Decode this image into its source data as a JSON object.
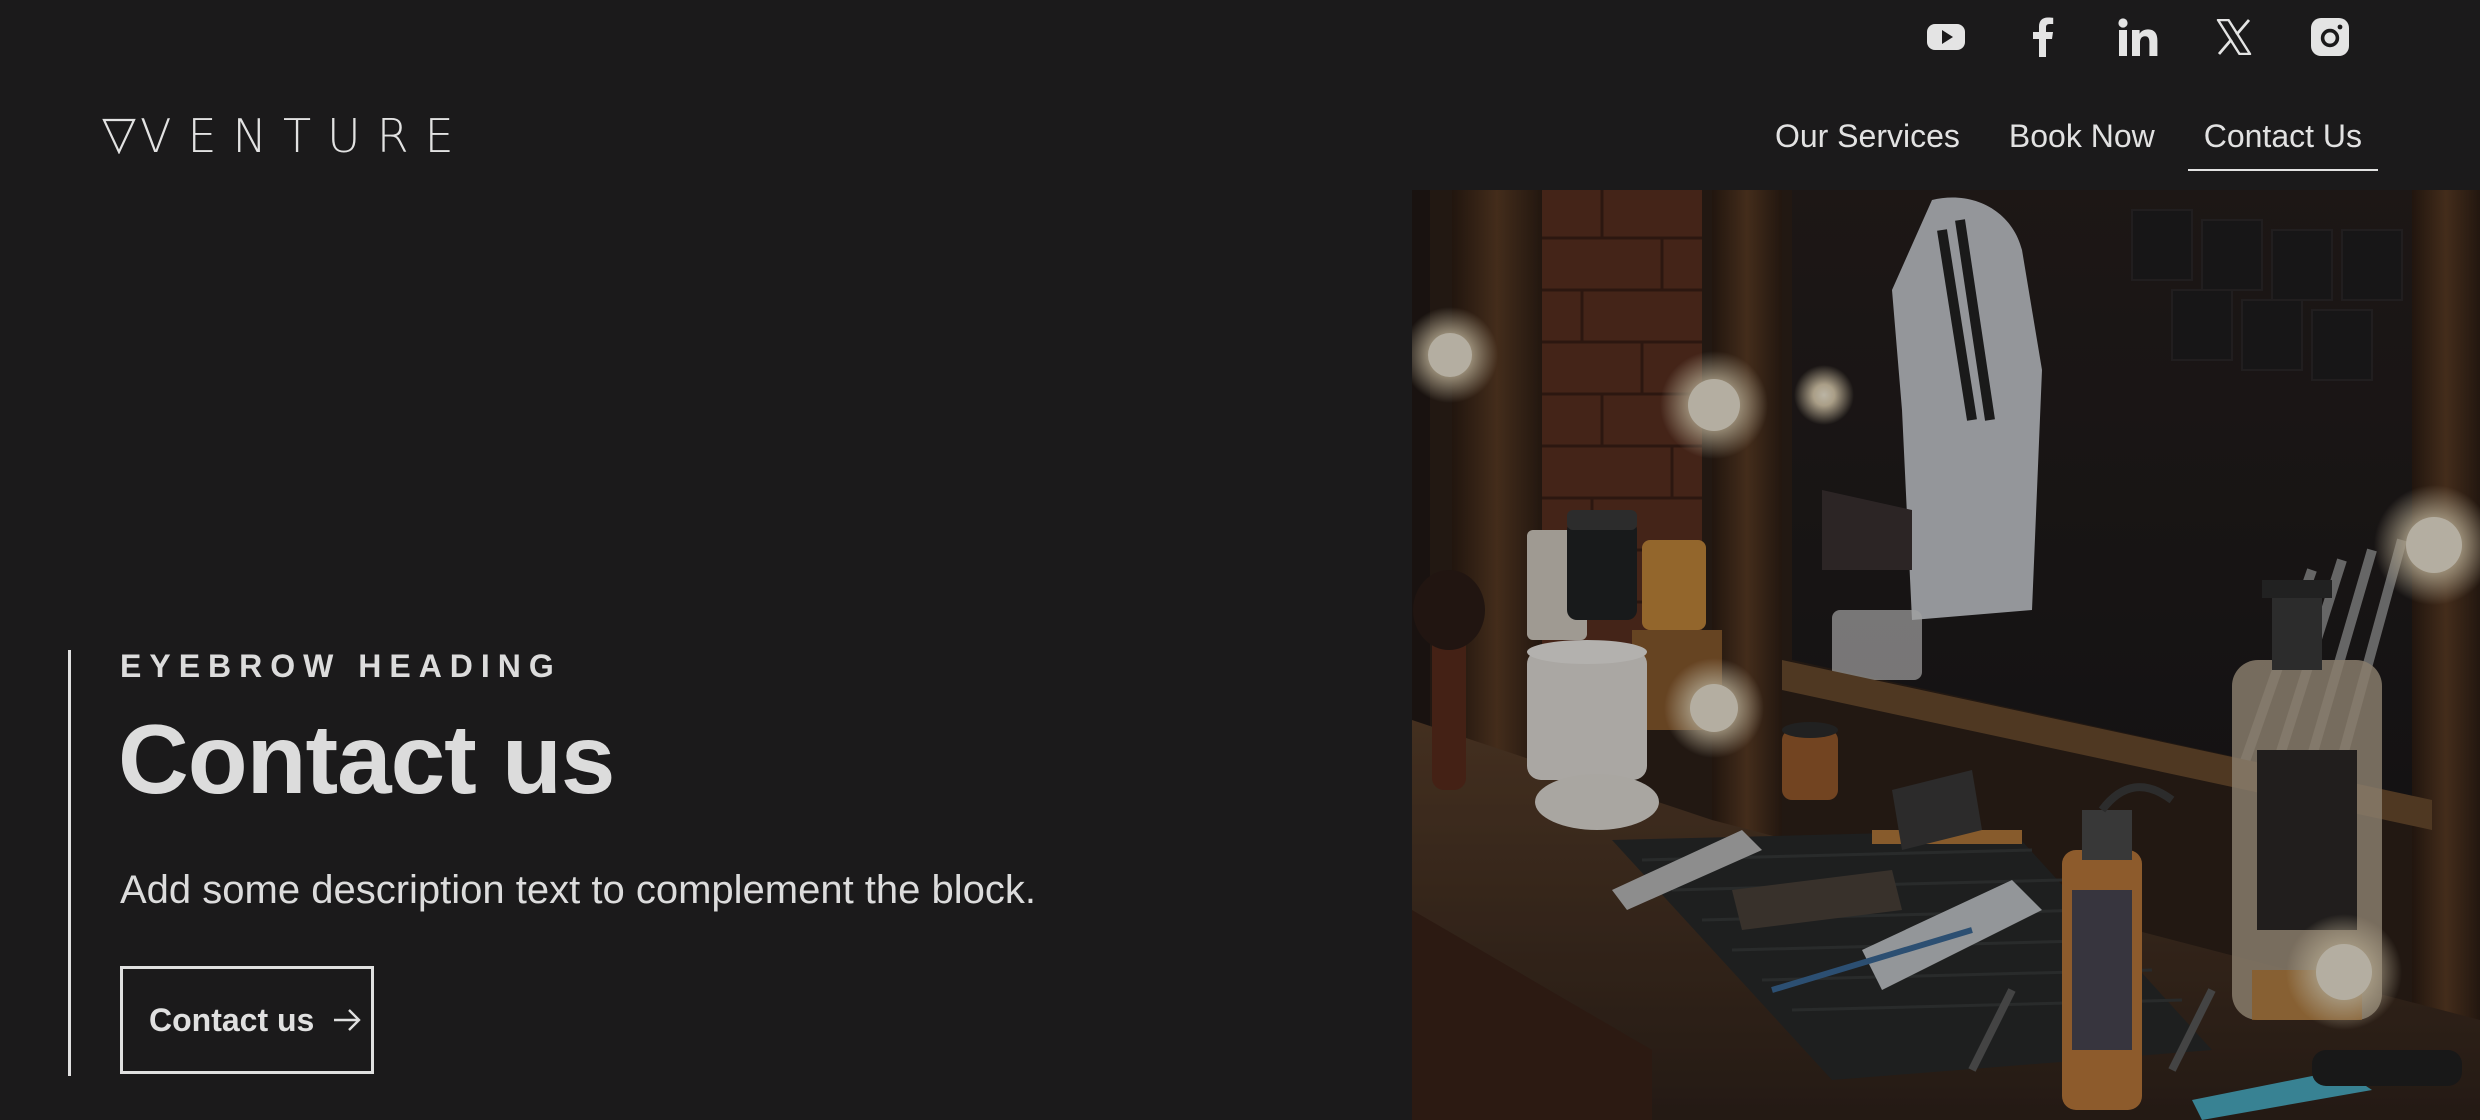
{
  "colors": {
    "background": "#1b1a1b",
    "text": "#dcdcdc",
    "accent": "#e0e0e0"
  },
  "social": [
    {
      "name": "YouTube",
      "icon": "youtube-icon"
    },
    {
      "name": "Facebook",
      "icon": "facebook-icon"
    },
    {
      "name": "LinkedIn",
      "icon": "linkedin-icon"
    },
    {
      "name": "X",
      "icon": "x-icon"
    },
    {
      "name": "Instagram",
      "icon": "instagram-icon"
    }
  ],
  "header": {
    "logo_text": "VENTURE",
    "logo_icon": "triangle-logo-icon"
  },
  "nav": {
    "items": [
      {
        "label": "Our Services"
      },
      {
        "label": "Book Now"
      },
      {
        "label": "Contact Us",
        "active": true
      }
    ]
  },
  "hero": {
    "eyebrow": "EYEBROW HEADING",
    "title": "Contact us",
    "description": "Add some description text to complement the block.",
    "cta_label": "Contact us",
    "cta_icon": "arrow-right-icon",
    "image_icon": "barbershop-photo"
  }
}
